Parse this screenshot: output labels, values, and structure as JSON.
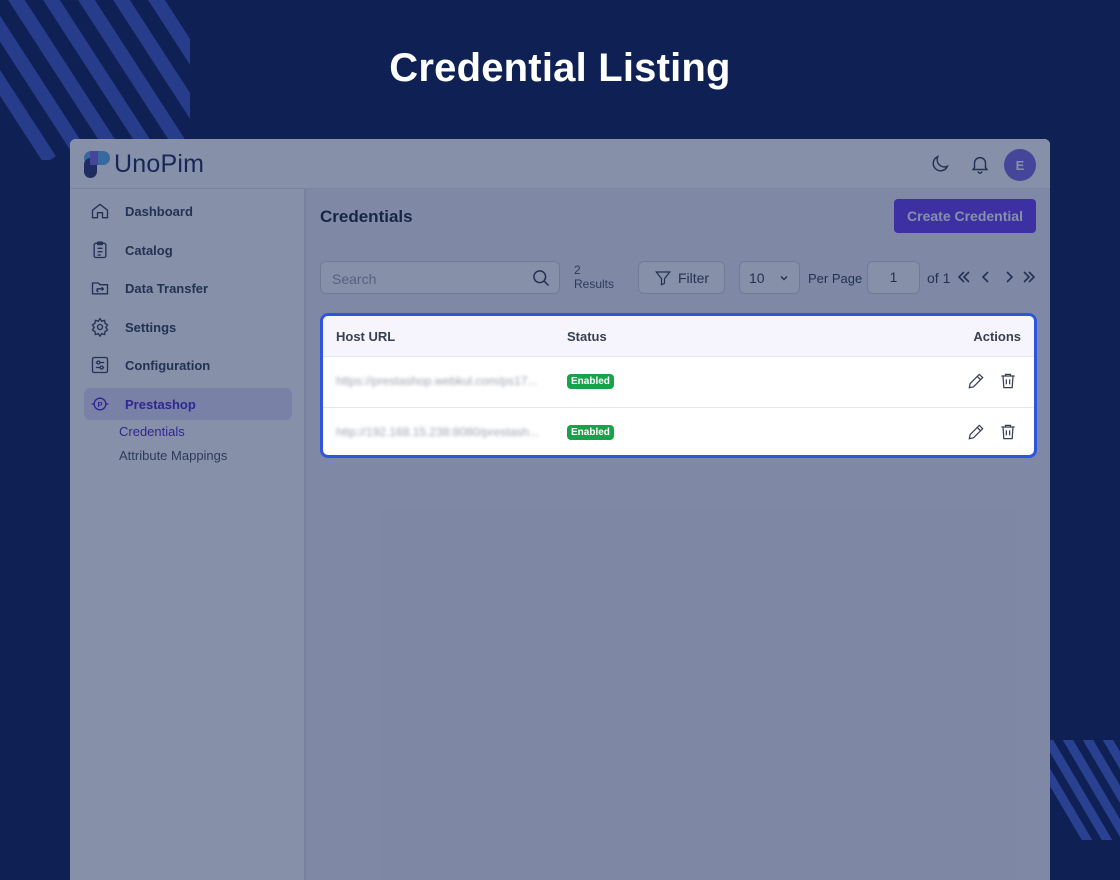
{
  "hero": {
    "title": "Credential Listing"
  },
  "brand": {
    "name": "UnoPim"
  },
  "header": {
    "avatar_initial": "E",
    "icons": [
      "moon-icon",
      "bell-icon"
    ]
  },
  "sidebar": {
    "items": [
      {
        "label": "Dashboard",
        "icon": "home-icon"
      },
      {
        "label": "Catalog",
        "icon": "clipboard-icon"
      },
      {
        "label": "Data Transfer",
        "icon": "folder-transfer-icon"
      },
      {
        "label": "Settings",
        "icon": "gear-icon"
      },
      {
        "label": "Configuration",
        "icon": "sliders-icon"
      },
      {
        "label": "Prestashop",
        "icon": "prestashop-icon",
        "active": true
      }
    ],
    "sub_items": [
      {
        "label": "Credentials",
        "active": true
      },
      {
        "label": "Attribute Mappings"
      }
    ]
  },
  "main": {
    "title": "Credentials",
    "create_label": "Create Credential",
    "search_placeholder": "Search",
    "results_count": "2",
    "results_label": "Results",
    "filter_label": "Filter",
    "per_page_value": "10",
    "per_page_label": "Per Page",
    "page_value": "1",
    "of_label": "of 1"
  },
  "table": {
    "headers": {
      "host": "Host URL",
      "status": "Status",
      "actions": "Actions"
    },
    "rows": [
      {
        "host": "https://prestashop.webkul.com/ps17...",
        "status": "Enabled"
      },
      {
        "host": "http://192.168.15.238:8080/prestash...",
        "status": "Enabled"
      }
    ]
  },
  "colors": {
    "background": "#0f2154",
    "accent": "#6a3ef0",
    "status_enabled": "#16a34a",
    "highlight_border": "#2f55e0"
  }
}
